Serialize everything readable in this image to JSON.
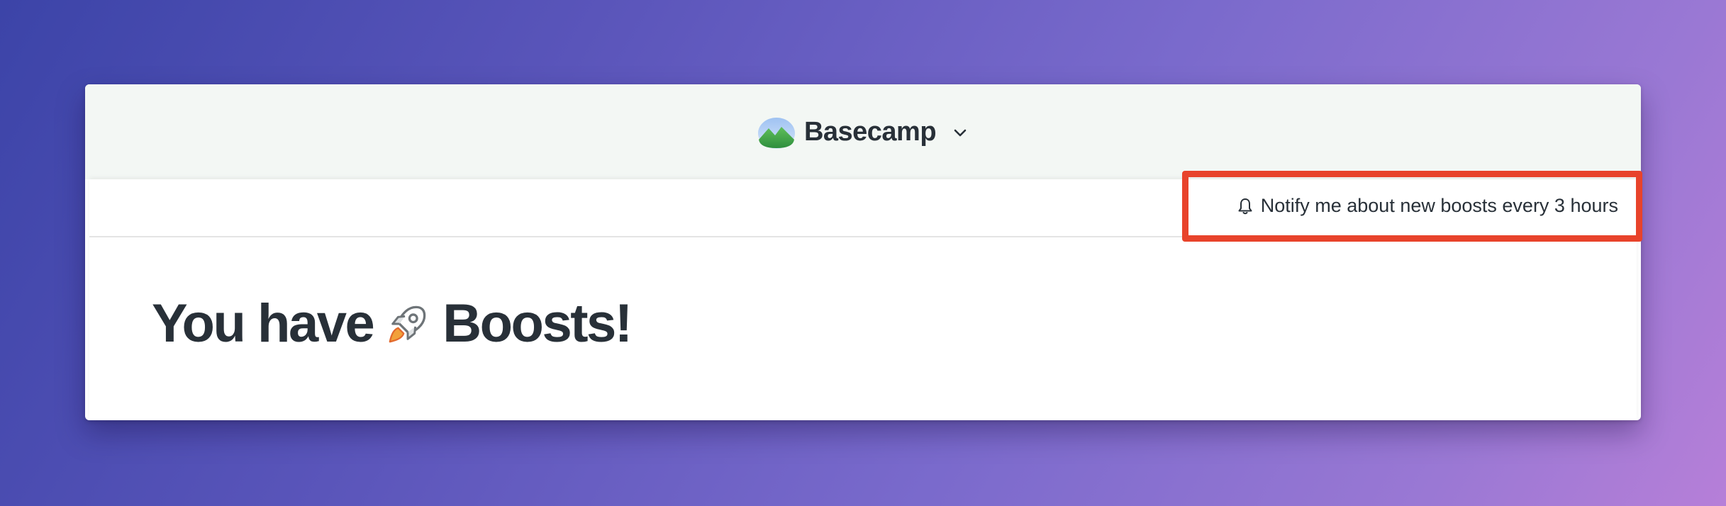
{
  "app": {
    "name": "Basecamp"
  },
  "toolbar": {
    "notify_label": "Notify me about new boosts every 3 hours"
  },
  "main": {
    "title_before": "You have",
    "title_after": "Boosts!"
  },
  "icons": {
    "logo": "basecamp-mountain-icon",
    "menu": "chevron-down-icon",
    "notify": "bell-icon",
    "title": "rocket-icon"
  },
  "colors": {
    "background_start": "#3c44a8",
    "background_end": "#b67fd8",
    "header_bg": "#f3f7f4",
    "text": "#283038",
    "highlight": "#e8432b"
  }
}
